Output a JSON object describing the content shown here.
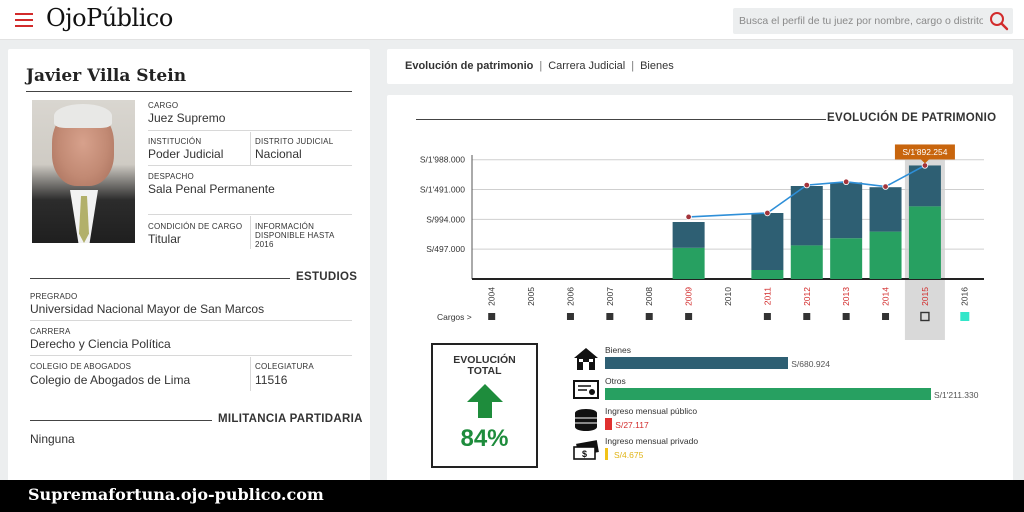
{
  "header": {
    "logo": "OjoPúblico",
    "search_placeholder": "Busca el perfil de tu juez por nombre, cargo o distrito"
  },
  "profile": {
    "name": "Javier Villa Stein",
    "cargo_label": "CARGO",
    "cargo": "Juez Supremo",
    "institucion_label": "INSTITUCIÓN",
    "institucion": "Poder Judicial",
    "distrito_label": "DISTRITO JUDICIAL",
    "distrito": "Nacional",
    "despacho_label": "DESPACHO",
    "despacho": "Sala Penal Permanente",
    "condicion_label": "CONDICIÓN DE CARGO",
    "condicion": "Titular",
    "info_label_1": "INFORMACIÓN",
    "info_label_2": "DISPONIBLE HASTA",
    "info_year": "2016"
  },
  "estudios": {
    "heading": "ESTUDIOS",
    "pregrado_label": "PREGRADO",
    "pregrado": "Universidad Nacional Mayor de San Marcos",
    "carrera_label": "CARRERA",
    "carrera": "Derecho y Ciencia Política",
    "colegio_label": "COLEGIO DE ABOGADOS",
    "colegio": "Colegio de Abogados de Lima",
    "colegiatura_label": "COLEGIATURA",
    "colegiatura": "11516"
  },
  "militancia": {
    "heading": "MILITANCIA PARTIDARIA",
    "value": "Ninguna"
  },
  "tabs": {
    "evolucion": "Evolución de patrimonio",
    "carrera": "Carrera Judicial",
    "bienes": "Bienes",
    "separator": "|"
  },
  "chart_title": "EVOLUCIÓN DE PATRIMONIO",
  "chart_data": {
    "type": "bar",
    "categories": [
      "2004",
      "2005",
      "2006",
      "2007",
      "2008",
      "2009",
      "2010",
      "2011",
      "2012",
      "2013",
      "2014",
      "2015",
      "2016"
    ],
    "highlight_years": [
      "2009",
      "2011",
      "2012",
      "2013",
      "2014",
      "2015"
    ],
    "selected_year": "2015",
    "series": [
      {
        "values": [
          null,
          null,
          null,
          null,
          null,
          520000,
          null,
          150000,
          560000,
          680000,
          790000,
          1211330,
          null
        ],
        "color": "#27a061"
      },
      {
        "values": [
          null,
          null,
          null,
          null,
          null,
          430000,
          null,
          950000,
          990000,
          930000,
          740000,
          680924,
          null
        ],
        "color": "#2e5f73"
      }
    ],
    "line_values": [
      null,
      null,
      null,
      null,
      null,
      1035000,
      null,
      1100000,
      1565000,
      1620000,
      1540000,
      1892254,
      null
    ],
    "line_color": "#2e8fd8",
    "yticks": [
      497000,
      994000,
      1491000,
      1988000
    ],
    "ytick_labels": [
      "S/497.000",
      "S/994.000",
      "S/1'491.000",
      "S/1'988.000"
    ],
    "ylim": [
      0,
      2150000
    ],
    "tooltip": "S/1'892.254",
    "tooltip_color": "#c8650d",
    "cargos_label": "Cargos >",
    "cargo_markers": [
      "2004",
      "2006",
      "2007",
      "2008",
      "2009",
      "2011",
      "2012",
      "2013",
      "2014",
      "2015",
      "2016"
    ],
    "grid": true
  },
  "evolucion_total": {
    "title_1": "EVOLUCIÓN",
    "title_2": "TOTAL",
    "pct": "84%"
  },
  "legend": [
    {
      "label": "Bienes",
      "value": "S/680.924",
      "amount": 680924,
      "color": "#2e5f73",
      "icon": "house-icon"
    },
    {
      "label": "Otros",
      "value": "S/1'211.330",
      "amount": 1211330,
      "color": "#27a061",
      "icon": "certificate-icon"
    },
    {
      "label": "Ingreso mensual público",
      "value": "S/27.117",
      "amount": 27117,
      "color": "#e0302f",
      "icon": "coins-icon"
    },
    {
      "label": "Ingreso mensual privado",
      "value": "S/4.675",
      "amount": 4675,
      "color": "#f2c318",
      "icon": "cash-icon"
    }
  ],
  "footer": "Supremafortuna.ojo-publico.com"
}
